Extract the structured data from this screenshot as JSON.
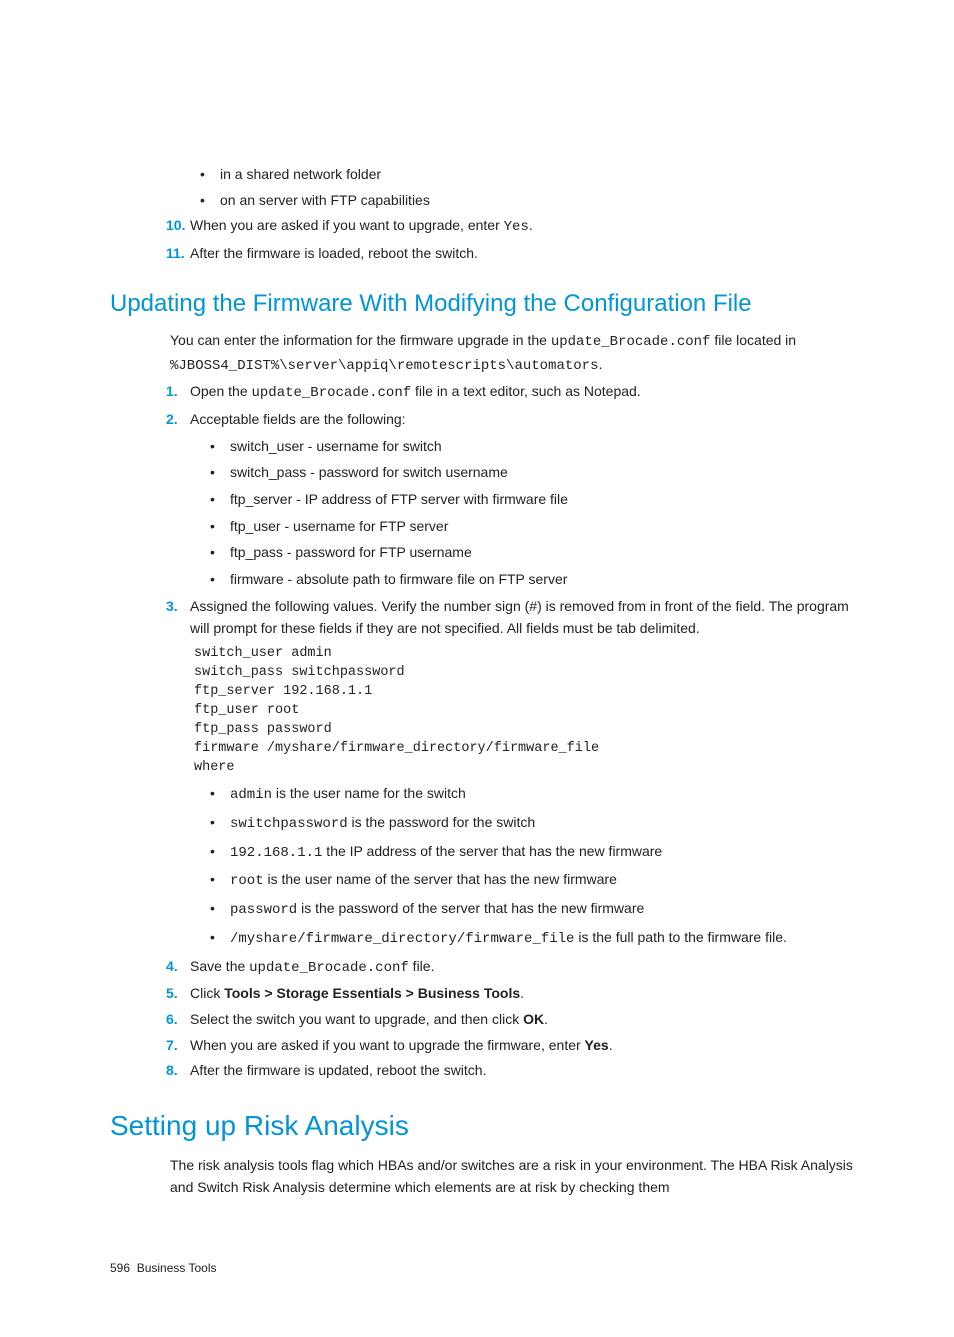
{
  "intro": {
    "b1": "in a shared network folder",
    "b2": "on an server with FTP capabilities"
  },
  "step10": {
    "num": "10.",
    "text_a": "When you are asked if you want to upgrade, enter ",
    "code": "Yes",
    "text_b": "."
  },
  "step11": {
    "num": "11.",
    "text": "After the firmware is loaded, reboot the switch."
  },
  "h2": "Updating the Firmware With Modifying the Configuration File",
  "para1": {
    "a": "You can enter the information for the firmware upgrade in the ",
    "code1": "update_Brocade.conf",
    "b": " file located in ",
    "code2": "%JBOSS4_DIST%\\server\\appiq\\remotescripts\\automators",
    "c": "."
  },
  "s1": {
    "num": "1.",
    "a": "Open the ",
    "code": "update_Brocade.conf",
    "b": " file in a text editor, such as Notepad."
  },
  "s2": {
    "num": "2.",
    "text": "Acceptable fields are the following:"
  },
  "s2_bullets": {
    "b1a": "switch_user",
    "b1b": " - username for switch",
    "b2a": "switch_pass",
    "b2b": " - password for switch username",
    "b3a": "ftp_server",
    "b3b": " - IP address of FTP server with firmware file",
    "b4a": "ftp_user",
    "b4b": " - username for FTP server",
    "b5a": "ftp_pass",
    "b5b": " - password for FTP username",
    "b6a": "firmware",
    "b6b": " - absolute path to firmware file on FTP server"
  },
  "s3": {
    "num": "3.",
    "text": "Assigned the following values. Verify the number sign (#) is removed from in front of the field. The program will prompt for these fields if they are not specified. All fields must be tab delimited."
  },
  "code_block": "switch_user admin\nswitch_pass switchpassword\nftp_server 192.168.1.1\nftp_user root\nftp_pass password\nfirmware /myshare/firmware_directory/firmware_file\nwhere",
  "s3_bullets": {
    "b1a": "admin",
    "b1b": " is the user name for the switch",
    "b2a": "switchpassword",
    "b2b": " is the password for the switch",
    "b3a": "192.168.1.1",
    "b3b": " the IP address of the server that has the new firmware",
    "b4a": "root",
    "b4b": " is the user name of the server that has the new firmware",
    "b5a": "password",
    "b5b": " is the password of the server that has the new firmware",
    "b6a": "/myshare/firmware_directory/firmware_file",
    "b6b": " is the full path to the firmware file."
  },
  "s4": {
    "num": "4.",
    "a": "Save the ",
    "code": "update_Brocade.conf",
    "b": " file."
  },
  "s5": {
    "num": "5.",
    "a": "Click ",
    "bold": "Tools > Storage Essentials > Business Tools",
    "b": "."
  },
  "s6": {
    "num": "6.",
    "a": "Select the switch you want to upgrade, and then click ",
    "bold": "OK",
    "b": "."
  },
  "s7": {
    "num": "7.",
    "a": "When you are asked if you want to upgrade the firmware, enter ",
    "bold": "Yes",
    "b": "."
  },
  "s8": {
    "num": "8.",
    "text": "After the firmware is updated, reboot the switch."
  },
  "h1": "Setting up Risk Analysis",
  "para2": "The risk analysis tools flag which HBAs and/or switches are a risk in your environment. The HBA Risk Analysis and Switch Risk Analysis determine which elements are at risk by checking them",
  "footer": {
    "page": "596",
    "title": "Business Tools"
  }
}
